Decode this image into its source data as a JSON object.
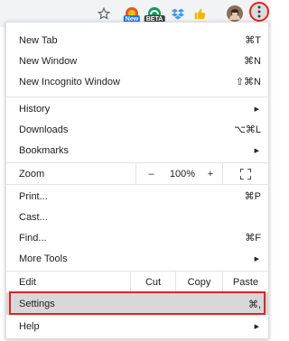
{
  "toolbar": {
    "star_icon": "star-icon",
    "extensions": [
      {
        "name": "new-extension-icon",
        "badge": "New",
        "color": "#e3572a",
        "badge_color": "#1a73e8"
      },
      {
        "name": "beta-extension-icon",
        "badge": "BETA",
        "color": "#0e9d58",
        "badge_color": "#3c4043"
      },
      {
        "name": "dropbox-icon",
        "color": "#3d9ae8"
      },
      {
        "name": "thumbs-up-icon",
        "color": "#f5b400"
      }
    ],
    "menu_button_icon": "three-dots-icon"
  },
  "menu": {
    "new_tab": {
      "label": "New Tab",
      "shortcut": "⌘T"
    },
    "new_window": {
      "label": "New Window",
      "shortcut": "⌘N"
    },
    "new_incognito": {
      "label": "New Incognito Window",
      "shortcut": "⇧⌘N"
    },
    "history": {
      "label": "History"
    },
    "downloads": {
      "label": "Downloads",
      "shortcut": "⌥⌘L"
    },
    "bookmarks": {
      "label": "Bookmarks"
    },
    "zoom": {
      "label": "Zoom",
      "minus": "–",
      "value": "100%",
      "plus": "+",
      "fullscreen_icon": "fullscreen-icon"
    },
    "print": {
      "label": "Print...",
      "shortcut": "⌘P"
    },
    "cast": {
      "label": "Cast..."
    },
    "find": {
      "label": "Find...",
      "shortcut": "⌘F"
    },
    "more_tools": {
      "label": "More Tools"
    },
    "edit": {
      "label": "Edit",
      "cut": "Cut",
      "copy": "Copy",
      "paste": "Paste"
    },
    "settings": {
      "label": "Settings",
      "shortcut": "⌘,"
    },
    "help": {
      "label": "Help"
    }
  },
  "colors": {
    "highlight_frame": "#e1231f",
    "settings_bg": "#d8d8d8"
  }
}
